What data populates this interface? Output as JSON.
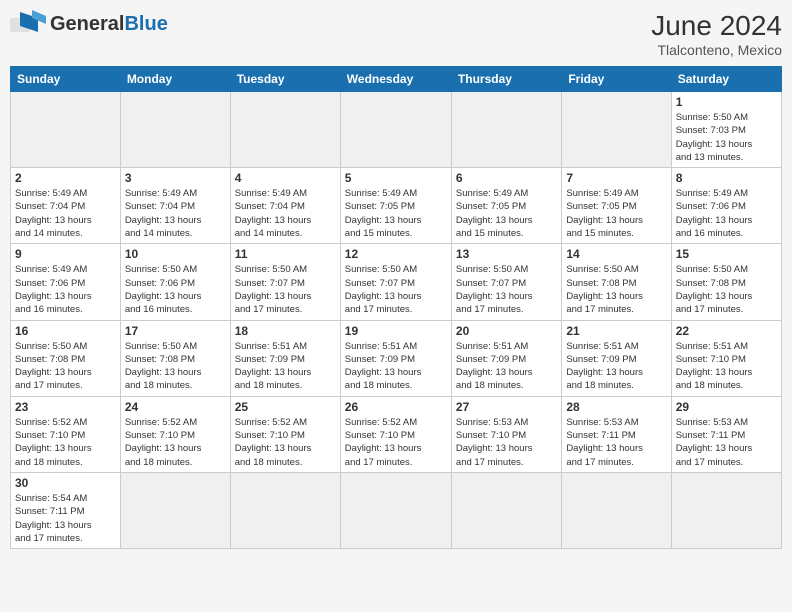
{
  "header": {
    "logo_general": "General",
    "logo_blue": "Blue",
    "month_title": "June 2024",
    "location": "Tlalconteno, Mexico"
  },
  "days_of_week": [
    "Sunday",
    "Monday",
    "Tuesday",
    "Wednesday",
    "Thursday",
    "Friday",
    "Saturday"
  ],
  "weeks": [
    [
      {
        "day": "",
        "empty": true
      },
      {
        "day": "",
        "empty": true
      },
      {
        "day": "",
        "empty": true
      },
      {
        "day": "",
        "empty": true
      },
      {
        "day": "",
        "empty": true
      },
      {
        "day": "",
        "empty": true
      },
      {
        "day": "1",
        "sunrise": "5:50 AM",
        "sunset": "7:03 PM",
        "daylight_hours": "13 hours",
        "daylight_minutes": "and 13 minutes."
      }
    ],
    [
      {
        "day": "2",
        "sunrise": "5:49 AM",
        "sunset": "7:04 PM",
        "daylight_hours": "13 hours",
        "daylight_minutes": "and 14 minutes."
      },
      {
        "day": "3",
        "sunrise": "5:49 AM",
        "sunset": "7:04 PM",
        "daylight_hours": "13 hours",
        "daylight_minutes": "and 14 minutes."
      },
      {
        "day": "4",
        "sunrise": "5:49 AM",
        "sunset": "7:04 PM",
        "daylight_hours": "13 hours",
        "daylight_minutes": "and 14 minutes."
      },
      {
        "day": "5",
        "sunrise": "5:49 AM",
        "sunset": "7:05 PM",
        "daylight_hours": "13 hours",
        "daylight_minutes": "and 15 minutes."
      },
      {
        "day": "6",
        "sunrise": "5:49 AM",
        "sunset": "7:05 PM",
        "daylight_hours": "13 hours",
        "daylight_minutes": "and 15 minutes."
      },
      {
        "day": "7",
        "sunrise": "5:49 AM",
        "sunset": "7:05 PM",
        "daylight_hours": "13 hours",
        "daylight_minutes": "and 15 minutes."
      },
      {
        "day": "8",
        "sunrise": "5:49 AM",
        "sunset": "7:06 PM",
        "daylight_hours": "13 hours",
        "daylight_minutes": "and 16 minutes."
      }
    ],
    [
      {
        "day": "9",
        "sunrise": "5:49 AM",
        "sunset": "7:06 PM",
        "daylight_hours": "13 hours",
        "daylight_minutes": "and 16 minutes."
      },
      {
        "day": "10",
        "sunrise": "5:50 AM",
        "sunset": "7:06 PM",
        "daylight_hours": "13 hours",
        "daylight_minutes": "and 16 minutes."
      },
      {
        "day": "11",
        "sunrise": "5:50 AM",
        "sunset": "7:07 PM",
        "daylight_hours": "13 hours",
        "daylight_minutes": "and 17 minutes."
      },
      {
        "day": "12",
        "sunrise": "5:50 AM",
        "sunset": "7:07 PM",
        "daylight_hours": "13 hours",
        "daylight_minutes": "and 17 minutes."
      },
      {
        "day": "13",
        "sunrise": "5:50 AM",
        "sunset": "7:07 PM",
        "daylight_hours": "13 hours",
        "daylight_minutes": "and 17 minutes."
      },
      {
        "day": "14",
        "sunrise": "5:50 AM",
        "sunset": "7:08 PM",
        "daylight_hours": "13 hours",
        "daylight_minutes": "and 17 minutes."
      },
      {
        "day": "15",
        "sunrise": "5:50 AM",
        "sunset": "7:08 PM",
        "daylight_hours": "13 hours",
        "daylight_minutes": "and 17 minutes."
      }
    ],
    [
      {
        "day": "16",
        "sunrise": "5:50 AM",
        "sunset": "7:08 PM",
        "daylight_hours": "13 hours",
        "daylight_minutes": "and 17 minutes."
      },
      {
        "day": "17",
        "sunrise": "5:50 AM",
        "sunset": "7:08 PM",
        "daylight_hours": "13 hours",
        "daylight_minutes": "and 18 minutes."
      },
      {
        "day": "18",
        "sunrise": "5:51 AM",
        "sunset": "7:09 PM",
        "daylight_hours": "13 hours",
        "daylight_minutes": "and 18 minutes."
      },
      {
        "day": "19",
        "sunrise": "5:51 AM",
        "sunset": "7:09 PM",
        "daylight_hours": "13 hours",
        "daylight_minutes": "and 18 minutes."
      },
      {
        "day": "20",
        "sunrise": "5:51 AM",
        "sunset": "7:09 PM",
        "daylight_hours": "13 hours",
        "daylight_minutes": "and 18 minutes."
      },
      {
        "day": "21",
        "sunrise": "5:51 AM",
        "sunset": "7:09 PM",
        "daylight_hours": "13 hours",
        "daylight_minutes": "and 18 minutes."
      },
      {
        "day": "22",
        "sunrise": "5:51 AM",
        "sunset": "7:10 PM",
        "daylight_hours": "13 hours",
        "daylight_minutes": "and 18 minutes."
      }
    ],
    [
      {
        "day": "23",
        "sunrise": "5:52 AM",
        "sunset": "7:10 PM",
        "daylight_hours": "13 hours",
        "daylight_minutes": "and 18 minutes."
      },
      {
        "day": "24",
        "sunrise": "5:52 AM",
        "sunset": "7:10 PM",
        "daylight_hours": "13 hours",
        "daylight_minutes": "and 18 minutes."
      },
      {
        "day": "25",
        "sunrise": "5:52 AM",
        "sunset": "7:10 PM",
        "daylight_hours": "13 hours",
        "daylight_minutes": "and 18 minutes."
      },
      {
        "day": "26",
        "sunrise": "5:52 AM",
        "sunset": "7:10 PM",
        "daylight_hours": "13 hours",
        "daylight_minutes": "and 17 minutes."
      },
      {
        "day": "27",
        "sunrise": "5:53 AM",
        "sunset": "7:10 PM",
        "daylight_hours": "13 hours",
        "daylight_minutes": "and 17 minutes."
      },
      {
        "day": "28",
        "sunrise": "5:53 AM",
        "sunset": "7:11 PM",
        "daylight_hours": "13 hours",
        "daylight_minutes": "and 17 minutes."
      },
      {
        "day": "29",
        "sunrise": "5:53 AM",
        "sunset": "7:11 PM",
        "daylight_hours": "13 hours",
        "daylight_minutes": "and 17 minutes."
      }
    ],
    [
      {
        "day": "30",
        "sunrise": "5:54 AM",
        "sunset": "7:11 PM",
        "daylight_hours": "13 hours",
        "daylight_minutes": "and 17 minutes."
      },
      {
        "day": "",
        "empty": true
      },
      {
        "day": "",
        "empty": true
      },
      {
        "day": "",
        "empty": true
      },
      {
        "day": "",
        "empty": true
      },
      {
        "day": "",
        "empty": true
      },
      {
        "day": "",
        "empty": true
      }
    ]
  ],
  "labels": {
    "sunrise": "Sunrise:",
    "sunset": "Sunset:",
    "daylight": "Daylight:"
  }
}
